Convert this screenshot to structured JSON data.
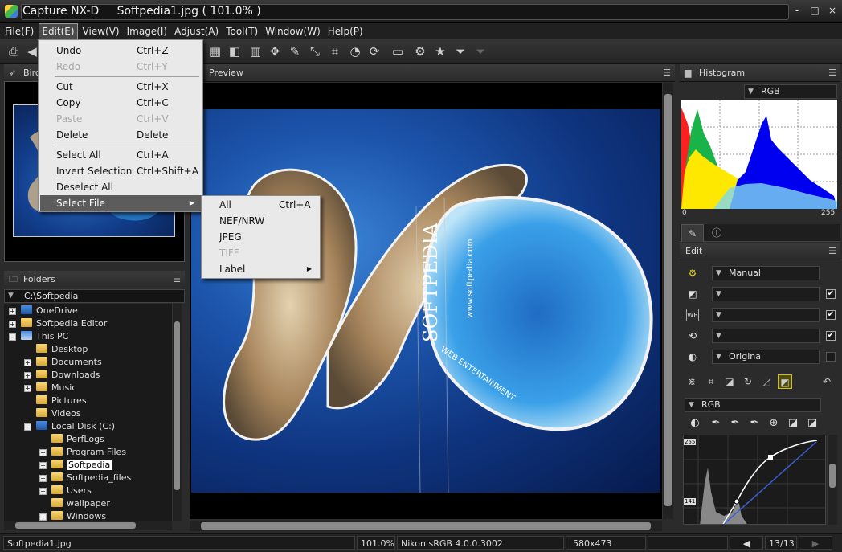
{
  "window": {
    "app_name": "Capture NX-D",
    "document": "Softpedia1.jpg ( 101.0% )",
    "title": "Capture NX-D     Softpedia1.jpg ( 101.0% )",
    "controls": {
      "minimize": "-",
      "maximize": "□",
      "close": "×"
    }
  },
  "menubar": [
    "File(F)",
    "Edit(E)",
    "View(V)",
    "Image(I)",
    "Adjust(A)",
    "Tool(T)",
    "Window(W)",
    "Help(P)"
  ],
  "active_menu": "Edit(E)",
  "edit_menu": {
    "items": [
      {
        "label": "Undo",
        "shortcut": "Ctrl+Z",
        "enabled": true
      },
      {
        "label": "Redo",
        "shortcut": "Ctrl+Y",
        "enabled": false
      },
      {
        "label": "Cut",
        "shortcut": "Ctrl+X",
        "enabled": true
      },
      {
        "label": "Copy",
        "shortcut": "Ctrl+C",
        "enabled": true
      },
      {
        "label": "Paste",
        "shortcut": "Ctrl+V",
        "enabled": false
      },
      {
        "label": "Delete",
        "shortcut": "Delete",
        "enabled": true
      },
      {
        "label": "Select All",
        "shortcut": "Ctrl+A",
        "enabled": true
      },
      {
        "label": "Invert Selection",
        "shortcut": "Ctrl+Shift+A",
        "enabled": true
      },
      {
        "label": "Deselect All",
        "shortcut": "",
        "enabled": true
      },
      {
        "label": "Select File",
        "shortcut": "",
        "enabled": true,
        "submenu": true,
        "highlighted": true
      }
    ]
  },
  "select_file_submenu": {
    "items": [
      {
        "label": "All",
        "shortcut": "Ctrl+A",
        "enabled": true
      },
      {
        "label": "NEF/NRW",
        "shortcut": "",
        "enabled": true
      },
      {
        "label": "JPEG",
        "shortcut": "",
        "enabled": true
      },
      {
        "label": "TIFF",
        "shortcut": "",
        "enabled": false
      },
      {
        "label": "Label",
        "shortcut": "",
        "enabled": true,
        "submenu": true
      }
    ]
  },
  "panels": {
    "birdseye_title": "Bird",
    "folders_title": "Folders",
    "preview_title": "Preview",
    "histogram_title": "Histogram",
    "edit_title": "Edit"
  },
  "folders": {
    "path": "C:\\Softpedia",
    "tree": [
      {
        "label": "OneDrive",
        "level": 0,
        "expander": "+",
        "icon": "cloud"
      },
      {
        "label": "Softpedia Editor",
        "level": 0,
        "expander": "+",
        "icon": "user-folder"
      },
      {
        "label": "This PC",
        "level": 0,
        "expander": "-",
        "icon": "pc"
      },
      {
        "label": "Desktop",
        "level": 1,
        "expander": "",
        "icon": "folder"
      },
      {
        "label": "Documents",
        "level": 1,
        "expander": "+",
        "icon": "folder"
      },
      {
        "label": "Downloads",
        "level": 1,
        "expander": "+",
        "icon": "folder"
      },
      {
        "label": "Music",
        "level": 1,
        "expander": "+",
        "icon": "folder"
      },
      {
        "label": "Pictures",
        "level": 1,
        "expander": "",
        "icon": "folder"
      },
      {
        "label": "Videos",
        "level": 1,
        "expander": "",
        "icon": "folder"
      },
      {
        "label": "Local Disk (C:)",
        "level": 1,
        "expander": "-",
        "icon": "drive"
      },
      {
        "label": "PerfLogs",
        "level": 2,
        "expander": "",
        "icon": "folder"
      },
      {
        "label": "Program Files",
        "level": 2,
        "expander": "+",
        "icon": "folder"
      },
      {
        "label": "Softpedia",
        "level": 2,
        "expander": "+",
        "icon": "folder",
        "selected": true
      },
      {
        "label": "Softpedia_files",
        "level": 2,
        "expander": "+",
        "icon": "folder"
      },
      {
        "label": "Users",
        "level": 2,
        "expander": "+",
        "icon": "folder"
      },
      {
        "label": "wallpaper",
        "level": 2,
        "expander": "",
        "icon": "folder"
      },
      {
        "label": "Windows",
        "level": 2,
        "expander": "+",
        "icon": "folder"
      }
    ]
  },
  "preview": {
    "watermark": "SOFTPEDIA",
    "image_text_1": "SOFTPEDIA",
    "image_text_2": "www.softpedia.com",
    "image_text_3": "WEB ENTERTAINMENT"
  },
  "histogram": {
    "channel": "RGB",
    "min_label": "0",
    "max_label": "255"
  },
  "edit_panel": {
    "picture_control": "Manual",
    "picture_control_checked": false,
    "row2": {
      "value": "",
      "checked": true
    },
    "row3": {
      "value": "",
      "checked": true
    },
    "row4": {
      "value": "",
      "checked": true
    },
    "dlighting": {
      "value": "Original",
      "checked": false
    },
    "curve_channel": "RGB",
    "curve_top_label": "255",
    "curve_mid_label": "141"
  },
  "statusbar": {
    "filename": "Softpedia1.jpg",
    "zoom": "101.0%",
    "profile": "Nikon sRGB 4.0.0.3002",
    "dimensions": "580x473",
    "page": "13/13"
  },
  "icons": {
    "print": "🖶",
    "back": "◀",
    "star": "★",
    "filter": "⏷",
    "monitor": "🖵",
    "gear": "⚙"
  }
}
